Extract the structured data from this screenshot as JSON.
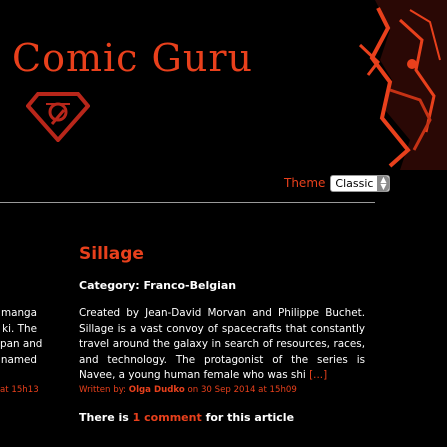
{
  "site": {
    "title": "Comic Guru"
  },
  "theme": {
    "label": "Theme",
    "selected": "Classic"
  },
  "previous_article": {
    "lines": [
      "manga",
      "ki. The",
      "pan and",
      "named"
    ],
    "meta_tail": "at 15h13"
  },
  "article": {
    "title": "Sillage",
    "category": "Category: Franco-Belgian",
    "body": "Created by Jean-David Morvan and Philippe Buchet. Sillage is a vast convoy of spacecrafts that constantly travel around the galaxy in search of resources, races, and technology. The protagonist of the series is Navee, a young human female who was shi",
    "more": "[...]",
    "meta": {
      "prefix": "Written by:",
      "author": "Olga Dudko",
      "on": "on",
      "date": "30 Sep 2014",
      "at": "at",
      "time": "15h09"
    },
    "comments": {
      "prefix": "There is",
      "link": "1 comment",
      "suffix": "for this article"
    }
  },
  "colors": {
    "accent": "#e8401c",
    "background": "#000000",
    "text": "#ffffff"
  }
}
